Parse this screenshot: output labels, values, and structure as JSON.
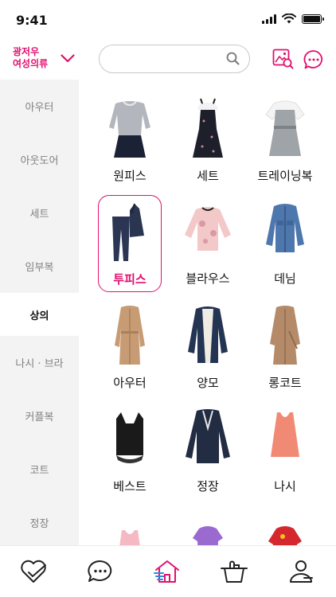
{
  "status": {
    "time": "9:41"
  },
  "header": {
    "location_line1": "광저우",
    "location_line2": "여성의류",
    "search_placeholder": "",
    "accent_color": "#e0116f"
  },
  "sidebar": {
    "items": [
      {
        "label": "아우터"
      },
      {
        "label": "아웃도어"
      },
      {
        "label": "세트"
      },
      {
        "label": "임부복"
      },
      {
        "label": "상의",
        "active": true
      },
      {
        "label": "나시 · 브라"
      },
      {
        "label": "커플복"
      },
      {
        "label": "코트"
      },
      {
        "label": "정장"
      }
    ]
  },
  "categories": [
    {
      "label": "원피스",
      "icon": "sweater-skirt-image"
    },
    {
      "label": "세트",
      "icon": "floral-dress-image"
    },
    {
      "label": "트레이닝복",
      "icon": "training-top-image"
    },
    {
      "label": "투피스",
      "icon": "two-piece-suit-image",
      "selected": true
    },
    {
      "label": "블라우스",
      "icon": "blouse-image"
    },
    {
      "label": "데님",
      "icon": "denim-jacket-image"
    },
    {
      "label": "아우터",
      "icon": "trench-coat-image"
    },
    {
      "label": "양모",
      "icon": "wool-parka-image"
    },
    {
      "label": "롱코트",
      "icon": "long-coat-image"
    },
    {
      "label": "베스트",
      "icon": "vest-image"
    },
    {
      "label": "정장",
      "icon": "blazer-image"
    },
    {
      "label": "나시",
      "icon": "tank-top-image"
    },
    {
      "label": "",
      "icon": "pink-tank-image"
    },
    {
      "label": "",
      "icon": "purple-top-image"
    },
    {
      "label": "",
      "icon": "floral-top-image"
    }
  ],
  "nav": [
    {
      "icon": "heart-check-icon"
    },
    {
      "icon": "chat-bubble-icon"
    },
    {
      "icon": "home-icon",
      "active": true
    },
    {
      "icon": "shopping-bag-icon"
    },
    {
      "icon": "profile-icon"
    }
  ]
}
